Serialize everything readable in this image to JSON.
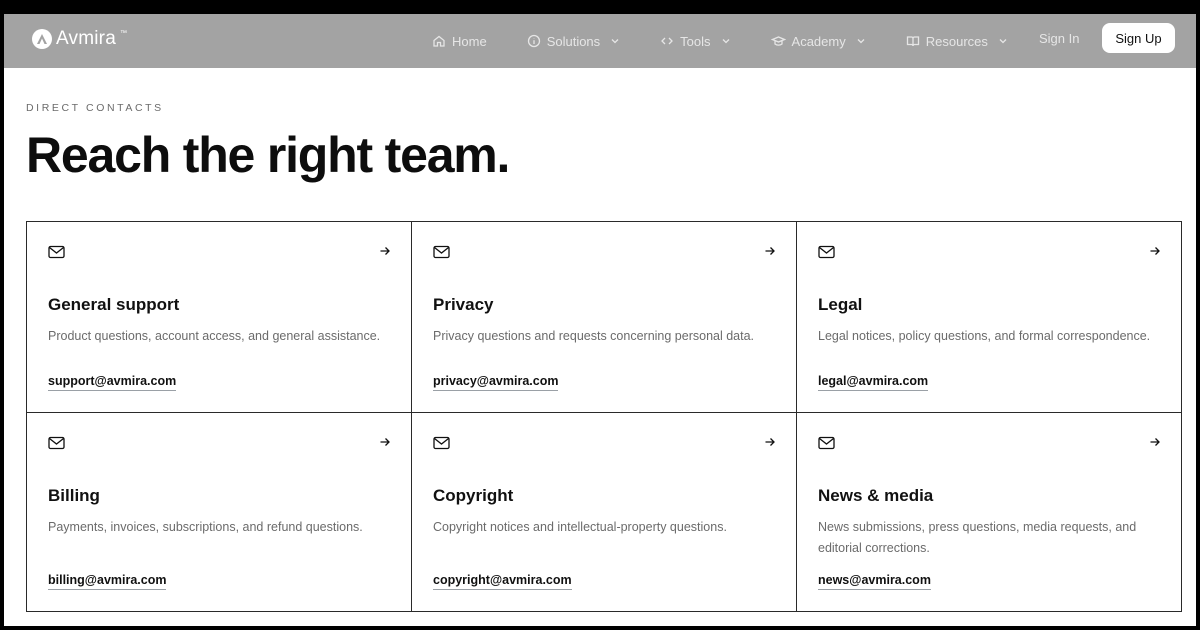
{
  "brand": {
    "name": "Avmira",
    "tm": "™"
  },
  "nav": {
    "items": [
      {
        "label": "Home",
        "icon": "home-icon",
        "dropdown": false
      },
      {
        "label": "Solutions",
        "icon": "info-circle-icon",
        "dropdown": true
      },
      {
        "label": "Tools",
        "icon": "code-icon",
        "dropdown": true
      },
      {
        "label": "Academy",
        "icon": "graduation-cap-icon",
        "dropdown": true
      },
      {
        "label": "Resources",
        "icon": "book-icon",
        "dropdown": true
      }
    ],
    "sign_in": "Sign In",
    "sign_up": "Sign Up"
  },
  "hero": {
    "eyebrow": "DIRECT CONTACTS",
    "title": "Reach the right team."
  },
  "contacts": [
    {
      "title": "General support",
      "description": "Product questions, account access, and general assistance.",
      "email": "support@avmira.com"
    },
    {
      "title": "Privacy",
      "description": "Privacy questions and requests concerning personal data.",
      "email": "privacy@avmira.com"
    },
    {
      "title": "Legal",
      "description": "Legal notices, policy questions, and formal correspondence.",
      "email": "legal@avmira.com"
    },
    {
      "title": "Billing",
      "description": "Payments, invoices, subscriptions, and refund questions.",
      "email": "billing@avmira.com"
    },
    {
      "title": "Copyright",
      "description": "Copyright notices and intellectual-property questions.",
      "email": "copyright@avmira.com"
    },
    {
      "title": "News & media",
      "description": "News submissions, press questions, media requests, and editorial corrections.",
      "email": "news@avmira.com"
    }
  ],
  "colors": {
    "nav_bg": "#a3a3a3",
    "text_primary": "#0d0d0d",
    "text_muted": "#6b6b6b",
    "border": "#2a2a2a"
  }
}
